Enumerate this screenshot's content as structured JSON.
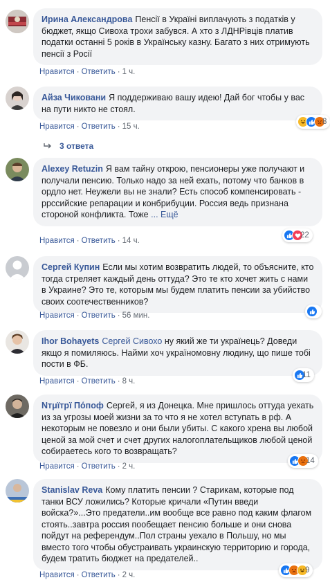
{
  "actions": {
    "like": "Нравится",
    "reply": "Ответить",
    "dot": "·"
  },
  "comments": [
    {
      "author": "Ирина Александрова",
      "text": "Пенсії в Україні виплачують з податків у бюджет, якщо Сивоха трохи забувся. А хто з ЛДНРівців платив податки останні 5 років в Українську казну. Багато з них отримують пенсії з Росії",
      "time": "1 ч."
    },
    {
      "author": "Айза Чиковани",
      "text": "Я поддерживаю вашу идею! Дай бог чтобы у вас на пути никто не стоял.",
      "time": "15 ч.",
      "reaction_count": "8",
      "reactions": [
        "haha",
        "like",
        "angry"
      ]
    },
    {
      "author": "Alexey Retuzin",
      "text": "Я вам тайну открою, пенсионеры уже получают и получали пенсию. Только надо за ней ехать, потому что банков в ордло нет. Неужели вы не знали? Есть способ компенсировать - ррссийские репарации и конбрибуции. Россия ведь признана стороной конфликта. Тоже",
      "more": "... Ещё",
      "time": "14 ч.",
      "reaction_count": "22",
      "reactions": [
        "like",
        "love"
      ]
    },
    {
      "author": "Сергей Купин",
      "text": "Если мы хотим возвратить людей, то объясните, кто тогда стреляет каждый день оттуда? Это те кто хочет жить с нами в Украине? Это те, которым мы будем платить пенсии за убийство своих соотечественников?",
      "time": "56 мин.",
      "reaction_count": "",
      "reactions": [
        "like"
      ]
    },
    {
      "author": "Ihor Bohayets",
      "mention": "Сергей Сивохо",
      "text": "ну який же ти українець? Доведи якщо я помиляюсь. Найми хоч україномовну людину, що пише тобі пости в ФБ.",
      "time": "8 ч.",
      "reaction_count": "11",
      "reactions": [
        "like"
      ]
    },
    {
      "author": "Νтμїтрї Пόпоф",
      "text": "Сергей, я из Донецка. Мне пришлось оттуда уехать из за угрозы моей жизни за то что я не хотел вступать в рф. А некоторым не повезло и они были убиты. С какого хрена вы любой ценой за мой счет и счет других налогоплательщиков любой ценой собираетесь кого то возвращать?",
      "time": "2 ч.",
      "reaction_count": "14",
      "reactions": [
        "like",
        "angry"
      ]
    },
    {
      "author": "Stanislav Reva",
      "text": "Кому платить пенсии ? Старикам, которые под танки ВСУ ложились? Которые кричали «Путин введи войска?»...Это предатели..им вообще все равно под каким флагом стоять..завтра россия пообещает пенсию больше и они снова пойдут на референдум..Пол страны уехало в Польшу, но мы вместо того чтобы обустраивать украинскую территорию и города, будем тратить бюджет на предателей..",
      "time": "2 ч.",
      "reaction_count": "9",
      "reactions": [
        "like",
        "angry",
        "haha"
      ]
    }
  ],
  "replies": {
    "label": "3 ответа"
  },
  "colors": {
    "link": "#385898",
    "bubble": "#f2f3f5",
    "meta": "#606770",
    "like": "#1877f2",
    "love": "#f33e58",
    "angry": "#e9710f",
    "haha": "#f7b928"
  }
}
